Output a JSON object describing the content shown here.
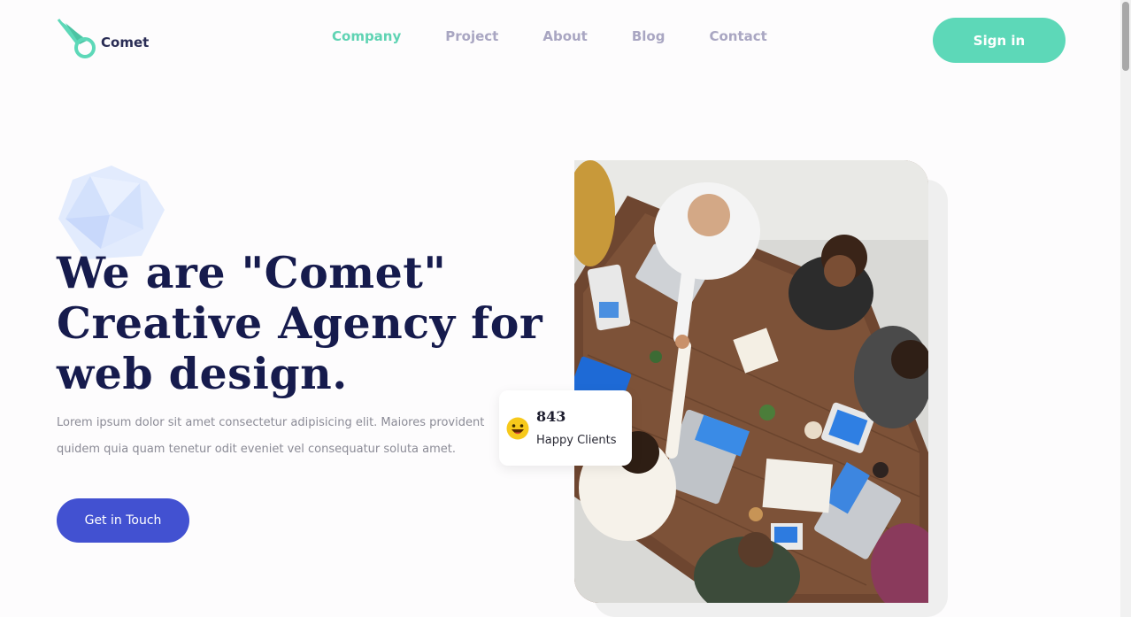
{
  "brand": {
    "name": "Comet",
    "accent": "#5dd8b8",
    "primary": "#4251d1",
    "heading_color": "#161b4d"
  },
  "nav": {
    "items": [
      {
        "label": "Company",
        "active": true
      },
      {
        "label": "Project",
        "active": false
      },
      {
        "label": "About",
        "active": false
      },
      {
        "label": "Blog",
        "active": false
      },
      {
        "label": "Contact",
        "active": false
      }
    ],
    "signin_label": "Sign in"
  },
  "hero": {
    "title_lines": [
      "We are \"Comet\"",
      "Creative Agency for",
      "web design."
    ],
    "description_lines": [
      "Lorem ipsum dolor sit amet consectetur adipisicing elit. Maiores provident",
      "quidem quia quam tenetur odit eveniet vel consequatur soluta amet."
    ],
    "cta_label": "Get in Touch"
  },
  "stats": {
    "count": "843",
    "label": "Happy Clients",
    "icon": "smiley-icon"
  },
  "icons": {
    "logo": "comet-logo-icon",
    "decoration": "gem-icon"
  }
}
